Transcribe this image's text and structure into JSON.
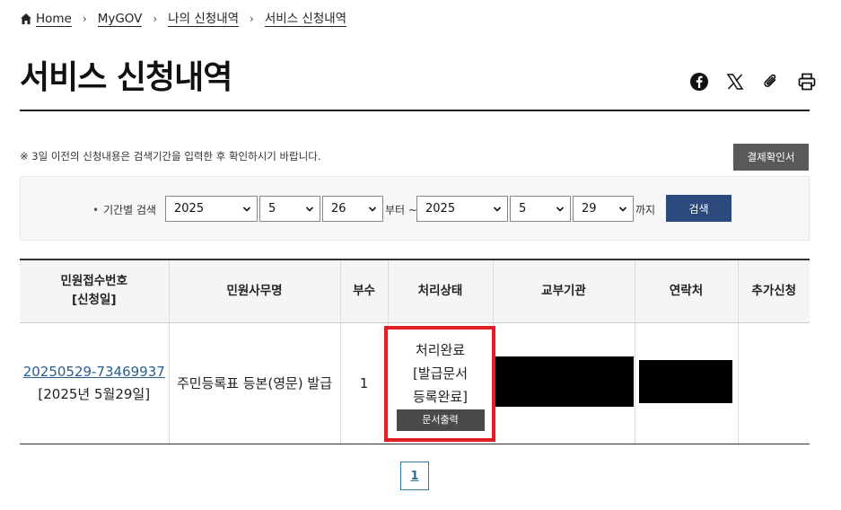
{
  "breadcrumb": {
    "home": "Home",
    "items": [
      "MyGOV",
      "나의 신청내역",
      "서비스 신청내역"
    ]
  },
  "page": {
    "title": "서비스 신청내역"
  },
  "share": {
    "icons": [
      "facebook-icon",
      "x-icon",
      "attach-link-icon",
      "print-icon"
    ]
  },
  "notice": "※ 3일 이전의 신청내용은 검색기간을 입력한 후 확인하시기 바랍니다.",
  "receipt_button": "결제확인서",
  "search": {
    "label": "기간별 검색",
    "from": {
      "year": "2025",
      "month": "5",
      "day": "26"
    },
    "from_suffix": "부터 ~",
    "to": {
      "year": "2025",
      "month": "5",
      "day": "29"
    },
    "to_suffix": "까지",
    "button": "검색"
  },
  "table": {
    "headers": {
      "app_no": "민원접수번호",
      "app_date": "[신청일]",
      "service": "민원사무명",
      "copies": "부수",
      "status": "처리상태",
      "agency": "교부기관",
      "contact": "연락처",
      "extra": "추가신청"
    },
    "rows": [
      {
        "app_no": "20250529-73469937",
        "app_date": "[2025년 5월29일]",
        "service": "주민등록표 등본(영문) 발급",
        "copies": "1",
        "status_line1": "처리완료",
        "status_line2": "[발급문서",
        "status_line3": "등록완료]",
        "print_button": "문서출력",
        "agency": "",
        "contact": "",
        "extra": ""
      }
    ]
  },
  "pagination": {
    "current": "1"
  },
  "colors": {
    "accent_blue": "#2c4a7c",
    "highlight_red": "#e01e25",
    "link_blue": "#2a5d8f"
  }
}
